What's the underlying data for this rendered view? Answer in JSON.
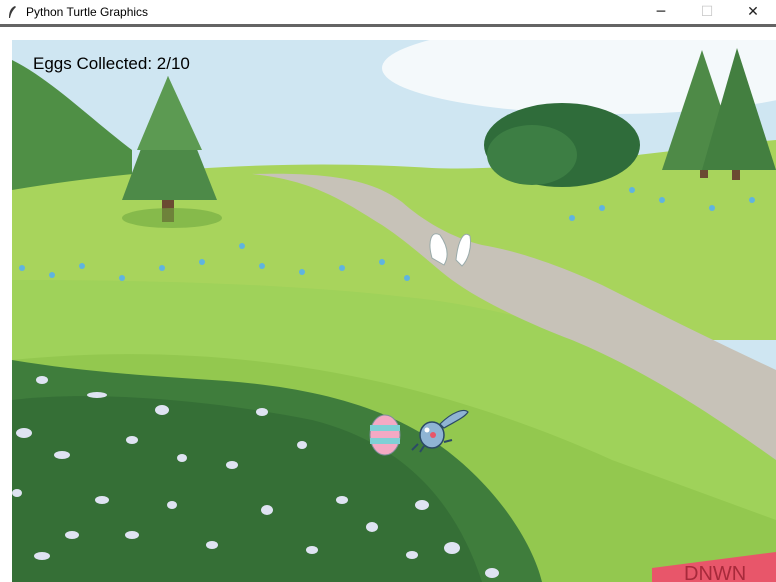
{
  "window": {
    "title": "Python Turtle Graphics",
    "controls": {
      "minimize": "─",
      "maximize": "☐",
      "close": "✕"
    }
  },
  "game": {
    "hud": {
      "label": "Eggs Collected:",
      "collected": 2,
      "total": 10,
      "text": "Eggs Collected: 2/10"
    },
    "sign_text": "DNWN",
    "colors": {
      "sky": "#cfe6f2",
      "grass_light": "#a6d35a",
      "grass_dark": "#7fb83a",
      "path": "#c8c2b8",
      "bush": "#3f7d3c",
      "egg_pink": "#f4a9c4",
      "egg_blue": "#7fd0d6",
      "bunny": "#8fb4d4",
      "sign": "#e8566a"
    }
  }
}
